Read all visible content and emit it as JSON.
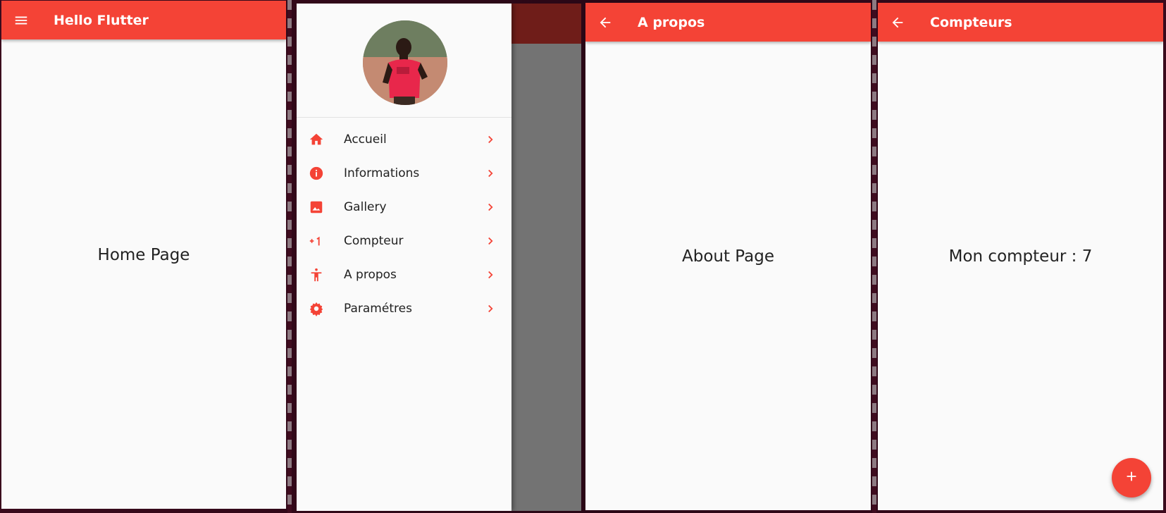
{
  "theme": {
    "primary": "#f44336",
    "scrim": "#737373",
    "background": "#fafafa"
  },
  "home": {
    "title": "Hello Flutter",
    "nav_icon": "menu-icon",
    "body_text": "Home Page"
  },
  "drawer": {
    "avatar": "profile-photo",
    "items": [
      {
        "label": "Accueil",
        "icon": "home-icon"
      },
      {
        "label": "Informations",
        "icon": "info-icon"
      },
      {
        "label": "Gallery",
        "icon": "image-icon"
      },
      {
        "label": "Compteur",
        "icon": "plus-one-icon"
      },
      {
        "label": "A propos",
        "icon": "accessibility-icon"
      },
      {
        "label": "Paramétres",
        "icon": "settings-icon"
      }
    ],
    "trailing_icon": "chevron-right-icon"
  },
  "about": {
    "title": "A propos",
    "nav_icon": "arrow-back-icon",
    "body_text": "About Page"
  },
  "counter": {
    "title": "Compteurs",
    "nav_icon": "arrow-back-icon",
    "body_text": "Mon compteur : 7",
    "fab_icon": "add-icon"
  }
}
